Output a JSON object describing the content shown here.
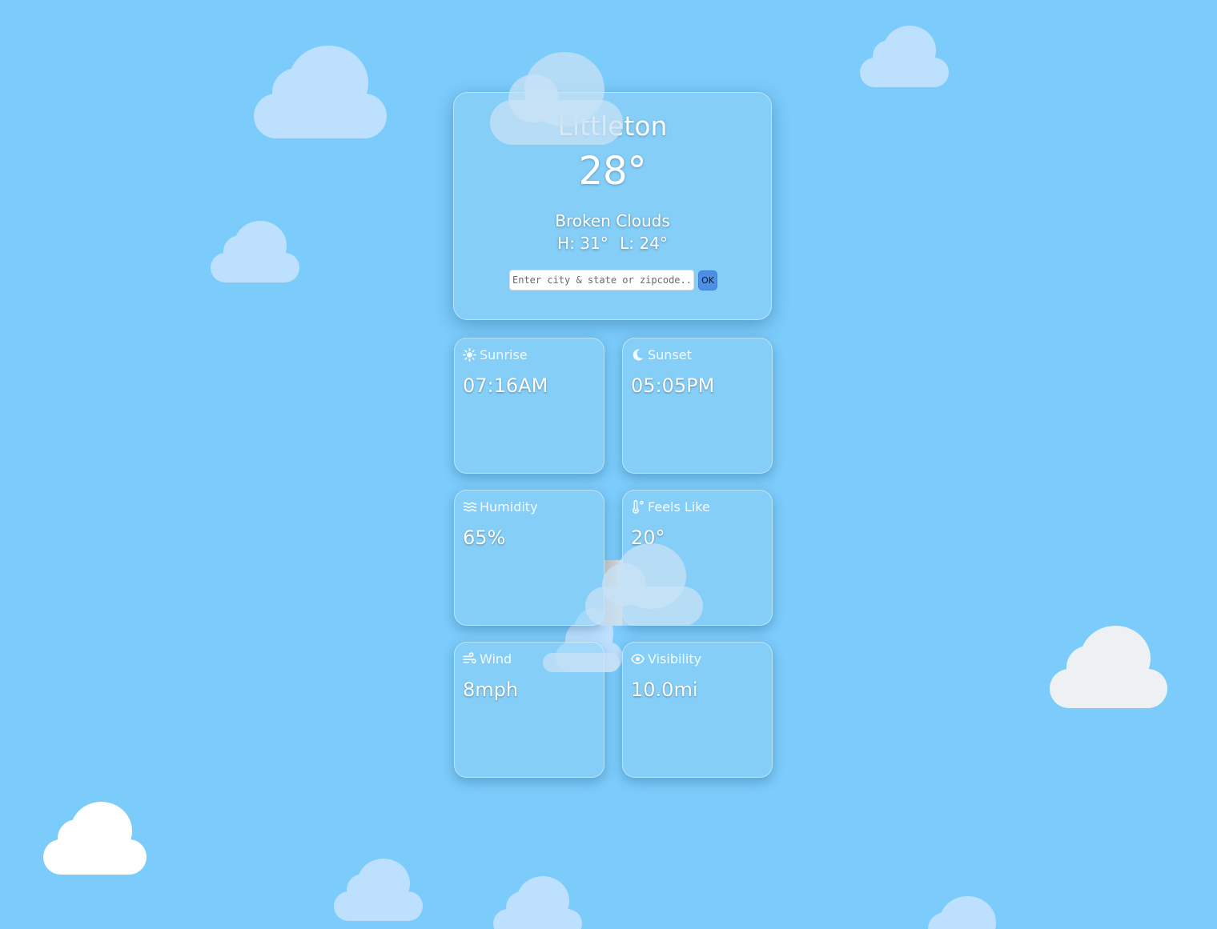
{
  "weather": {
    "city": "Littleton",
    "temperature": "28°",
    "description": "Broken Clouds",
    "high": "H: 31°",
    "low": "L: 24°"
  },
  "search": {
    "placeholder": "Enter city & state or zipcode...",
    "value": "",
    "button_label": "OK"
  },
  "tiles": [
    {
      "label": "Sunrise",
      "value": "07:16AM",
      "icon": "sun-icon"
    },
    {
      "label": "Sunset",
      "value": "05:05PM",
      "icon": "moon-icon"
    },
    {
      "label": "Humidity",
      "value": "65%",
      "icon": "water-icon"
    },
    {
      "label": "Feels Like",
      "value": "20°",
      "icon": "thermometer-icon"
    },
    {
      "label": "Wind",
      "value": "8mph",
      "icon": "wind-icon"
    },
    {
      "label": "Visibility",
      "value": "10.0mi",
      "icon": "eye-icon"
    }
  ],
  "colors": {
    "sky": "#7bcbfb",
    "card": "#8cd2f5",
    "ok_button": "#4e8fe6"
  }
}
